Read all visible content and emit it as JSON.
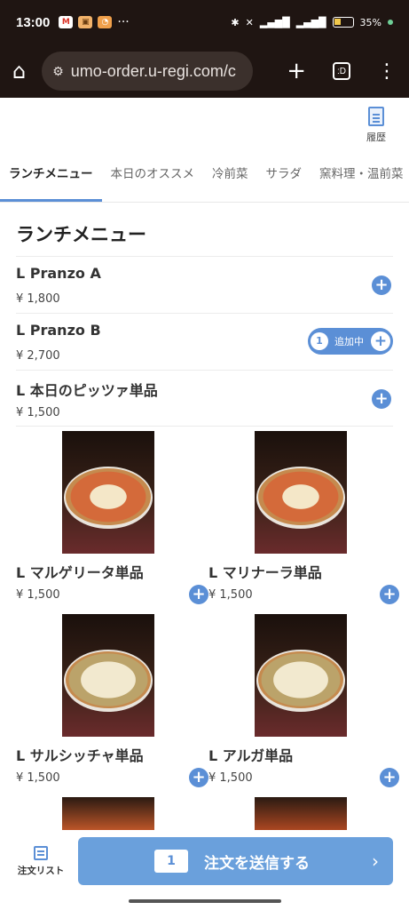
{
  "status_bar": {
    "time": "13:00",
    "apps": [
      {
        "icon": "gmail-icon",
        "glyph": "M",
        "bg": "#ffffff",
        "fg": "#d93025"
      },
      {
        "icon": "app-icon",
        "glyph": "▣",
        "bg": "#f2b36b",
        "fg": "#6b3d10"
      },
      {
        "icon": "app-icon",
        "glyph": "◔",
        "bg": "#f0a04b",
        "fg": "#ffffff"
      }
    ],
    "more": "···",
    "battery": "35%"
  },
  "browser": {
    "url": "umo-order.u-regi.com/c",
    "tab_count": ":D"
  },
  "header": {
    "history_label": "履歴"
  },
  "tabs": [
    {
      "label": "ランチメニュー",
      "active": true
    },
    {
      "label": "本日のオススメ",
      "active": false
    },
    {
      "label": "冷前菜",
      "active": false
    },
    {
      "label": "サラダ",
      "active": false
    },
    {
      "label": "窯料理・温前菜",
      "active": false
    }
  ],
  "section": {
    "title": "ランチメニュー"
  },
  "menu_items": [
    {
      "name": "L Pranzo A",
      "price": "¥ 1,800",
      "in_cart": false
    },
    {
      "name": "L Pranzo B",
      "price": "¥ 2,700",
      "in_cart": true,
      "qty": "1",
      "status": "追加中"
    },
    {
      "name": "L 本日のピッツァ単品",
      "price": "¥ 1,500",
      "in_cart": false
    }
  ],
  "grid_items": [
    {
      "name": "L マルゲリータ単品",
      "price": "¥ 1,500"
    },
    {
      "name": "L マリナーラ単品",
      "price": "¥ 1,500"
    },
    {
      "name": "L サルシッチャ単品",
      "price": "¥ 1,500"
    },
    {
      "name": "L アルガ単品",
      "price": "¥ 1,500"
    }
  ],
  "bottom": {
    "order_list_label": "注文リスト",
    "cart_count": "1",
    "submit_label": "注文を送信する",
    "chevron": "›"
  },
  "colors": {
    "accent": "#5b8fd6",
    "browser_bg": "#1f1512"
  }
}
